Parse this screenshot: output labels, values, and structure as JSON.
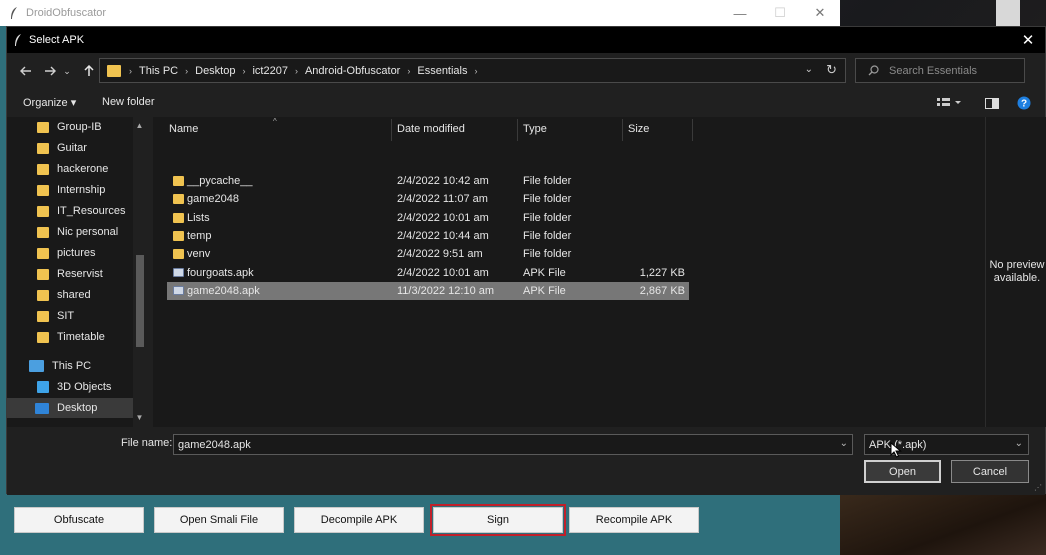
{
  "app": {
    "title": "DroidObfuscator",
    "controls": {
      "minimize": "—",
      "maximize": "☐",
      "close": "✕"
    },
    "buttons": [
      "Obfuscate",
      "Open Smali File",
      "Decompile APK",
      "Sign",
      "Recompile APK"
    ]
  },
  "dialog": {
    "title": "Select APK",
    "close": "✕",
    "breadcrumb": [
      "This PC",
      "Desktop",
      "ict2207",
      "Android-Obfuscator",
      "Essentials"
    ],
    "search_placeholder": "Search Essentials",
    "toolbar": {
      "organize": "Organize ▾",
      "new_folder": "New folder"
    },
    "sidebar": {
      "items": [
        {
          "label": "Group-IB",
          "kind": "folder"
        },
        {
          "label": "Guitar",
          "kind": "folder"
        },
        {
          "label": "hackerone",
          "kind": "folder"
        },
        {
          "label": "Internship",
          "kind": "folder"
        },
        {
          "label": "IT_Resources",
          "kind": "folder"
        },
        {
          "label": "Nic personal",
          "kind": "folder"
        },
        {
          "label": "pictures",
          "kind": "folder"
        },
        {
          "label": "Reservist",
          "kind": "folder"
        },
        {
          "label": "shared",
          "kind": "folder"
        },
        {
          "label": "SIT",
          "kind": "folder"
        },
        {
          "label": "Timetable",
          "kind": "folder"
        },
        {
          "label": "This PC",
          "kind": "pc"
        },
        {
          "label": "3D Objects",
          "kind": "obj"
        },
        {
          "label": "Desktop",
          "kind": "desk",
          "selected": true
        }
      ]
    },
    "columns": [
      "Name",
      "Date modified",
      "Type",
      "Size"
    ],
    "files": [
      {
        "name": "__pycache__",
        "date": "2/4/2022 10:42 am",
        "type": "File folder",
        "size": "",
        "kind": "folder"
      },
      {
        "name": "game2048",
        "date": "2/4/2022 11:07 am",
        "type": "File folder",
        "size": "",
        "kind": "folder"
      },
      {
        "name": "Lists",
        "date": "2/4/2022 10:01 am",
        "type": "File folder",
        "size": "",
        "kind": "folder"
      },
      {
        "name": "temp",
        "date": "2/4/2022 10:44 am",
        "type": "File folder",
        "size": "",
        "kind": "folder"
      },
      {
        "name": "venv",
        "date": "2/4/2022 9:51 am",
        "type": "File folder",
        "size": "",
        "kind": "folder"
      },
      {
        "name": "fourgoats.apk",
        "date": "2/4/2022 10:01 am",
        "type": "APK File",
        "size": "1,227 KB",
        "kind": "apk"
      },
      {
        "name": "game2048.apk",
        "date": "11/3/2022 12:10 am",
        "type": "APK File",
        "size": "2,867 KB",
        "kind": "apk",
        "selected": true
      }
    ],
    "preview_text": "No preview available.",
    "file_name_label": "File name:",
    "file_name_value": "game2048.apk",
    "file_type": "APK (*.apk)",
    "open_label": "Open",
    "cancel_label": "Cancel"
  },
  "colors": {
    "app_background": "#2f6f7b",
    "dialog_background": "#202020",
    "folder_icon": "#f0c350",
    "focus_outline": "#c0202a",
    "help_icon": "#1e7fe0"
  }
}
